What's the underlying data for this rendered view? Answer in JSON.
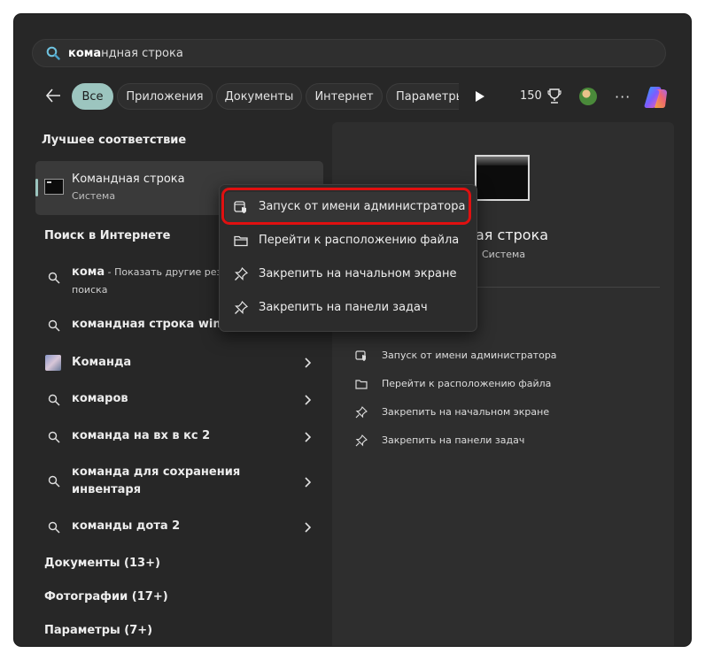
{
  "search": {
    "query_bold": "кома",
    "query_rest": "ндная строка"
  },
  "tabs": [
    {
      "label": "Все",
      "active": true
    },
    {
      "label": "Приложения"
    },
    {
      "label": "Документы"
    },
    {
      "label": "Интернет"
    },
    {
      "label": "Параметры"
    }
  ],
  "toolbar": {
    "points": "150"
  },
  "best_match": {
    "heading": "Лучшее соответствие",
    "title": "Командная строка",
    "subtitle": "Система"
  },
  "web": {
    "heading": "Поиск в Интернете",
    "items": [
      {
        "bold": "кома",
        "rest": " - Показать другие резул",
        "line2": "поиска"
      },
      {
        "bold": "командная строка window",
        "rest": ""
      },
      {
        "label": "Команда"
      },
      {
        "label": "комаров"
      },
      {
        "label": "команда на вх в кс 2"
      },
      {
        "line1": "команда для сохранения",
        "line2": "инвентаря"
      },
      {
        "label": "команды дота 2"
      }
    ]
  },
  "categories": [
    {
      "label": "Документы (13+)"
    },
    {
      "label": "Фотографии (17+)"
    },
    {
      "label": "Параметры (7+)"
    }
  ],
  "preview": {
    "title": "ндная строка",
    "subtitle": "Система",
    "actions": [
      {
        "label": "Запуск от имени администратора",
        "icon": "shield-icon"
      },
      {
        "label": "Перейти к расположению файла",
        "icon": "folder-icon"
      },
      {
        "label": "Закрепить на начальном экране",
        "icon": "pin-icon"
      },
      {
        "label": "Закрепить на панели задач",
        "icon": "pin-icon"
      }
    ]
  },
  "context_menu": {
    "items": [
      {
        "label": "Запуск от имени администратора",
        "icon": "shield-icon",
        "highlighted": true
      },
      {
        "label": "Перейти к расположению файла",
        "icon": "folder-icon"
      },
      {
        "label": "Закрепить на начальном экране",
        "icon": "pin-icon"
      },
      {
        "label": "Закрепить на панели задач",
        "icon": "pin-icon"
      }
    ]
  },
  "colors": {
    "accent": "#9cc5bf",
    "highlight_ring": "#e01010",
    "window_bg": "#272727"
  }
}
